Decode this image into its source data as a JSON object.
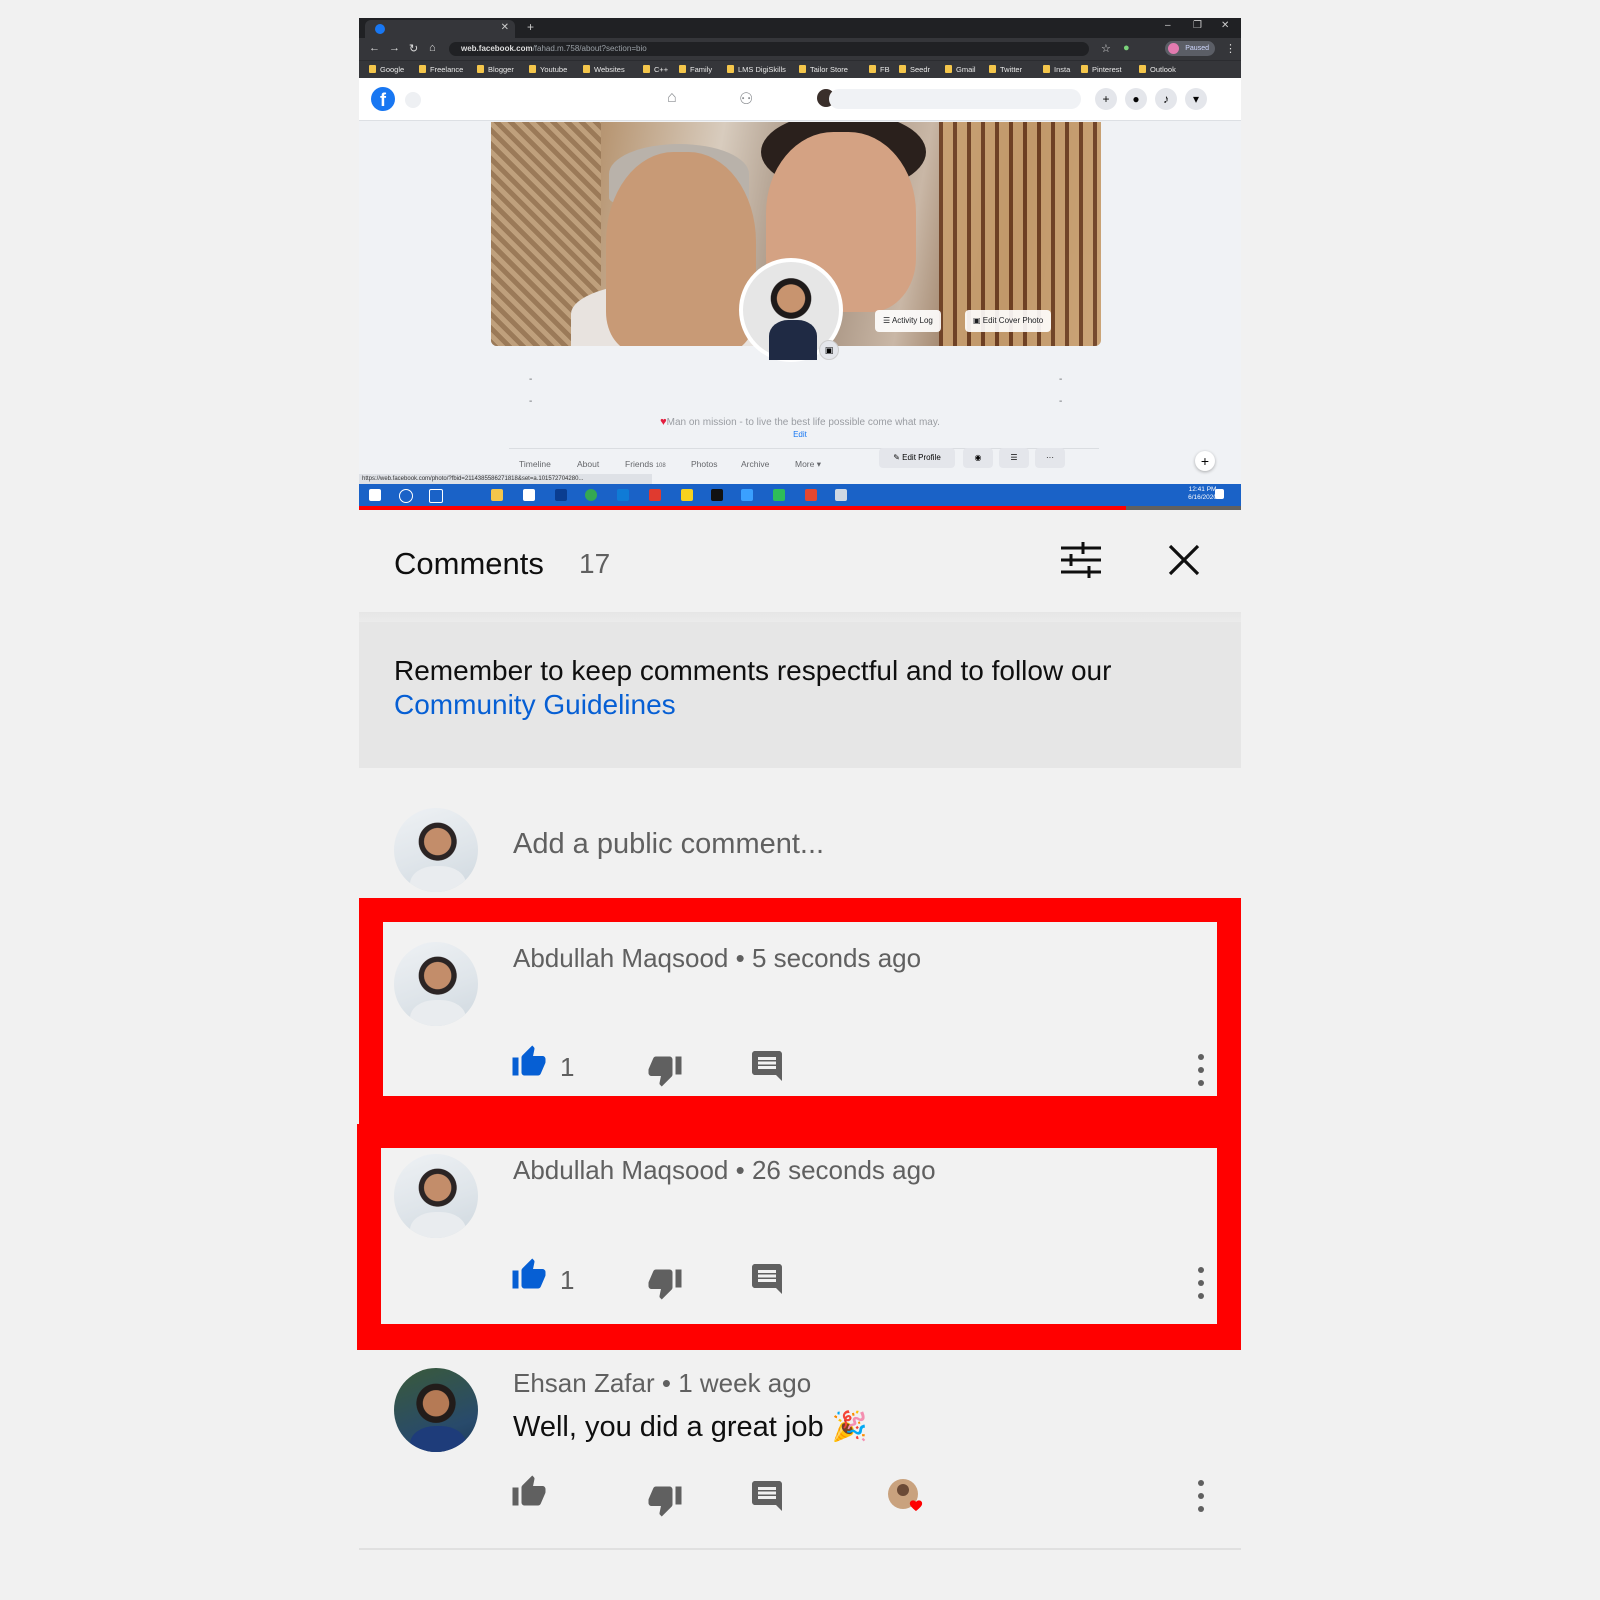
{
  "browser": {
    "url_host": "web.facebook.com",
    "url_path": "/fahad.m.758/about?section=bio",
    "paused_label": "Paused",
    "bookmarks": [
      "Google",
      "Freelance",
      "Blogger",
      "Youtube",
      "Websites",
      "C++",
      "Family",
      "LMS DigiSkills",
      "Tailor Store",
      "FB",
      "Seedr",
      "Gmail",
      "Twitter",
      "Insta",
      "Pinterest",
      "Outlook"
    ],
    "status_url": "https://web.facebook.com/photo/?fbid=2114385586271818&set=a.101572704280...",
    "taskbar_time": "12:41 PM",
    "taskbar_date": "6/16/2020"
  },
  "facebook": {
    "activity_log": "Activity Log",
    "edit_cover": "Edit Cover Photo",
    "bio": "Man on mission - to live the best life possible come what may.",
    "bio_edit": "Edit",
    "tabs": [
      "Timeline",
      "About",
      "Friends",
      "Photos",
      "Archive",
      "More ▾"
    ],
    "friends_count": "108",
    "edit_profile": "Edit Profile"
  },
  "video_progress": 0.87,
  "comments_panel": {
    "title": "Comments",
    "count": "17",
    "notice_text": "Remember to keep comments respectful and to follow our ",
    "notice_link": "Community Guidelines",
    "add_placeholder": "Add a public comment..."
  },
  "comments": [
    {
      "author": "Abdullah Maqsood",
      "time": "5 seconds ago",
      "text": "",
      "likes": "1",
      "liked": true
    },
    {
      "author": "Abdullah Maqsood",
      "time": "26 seconds ago",
      "text": "",
      "likes": "1",
      "liked": true
    },
    {
      "author": "Ehsan Zafar",
      "time": "1 week ago",
      "text": "Well, you did a great job 🎉",
      "likes": "",
      "liked": false,
      "creator_heart": true
    }
  ],
  "colors": {
    "highlight": "#ff0000",
    "liked": "#065fd4",
    "link": "#065fd4",
    "icon": "#606060"
  }
}
